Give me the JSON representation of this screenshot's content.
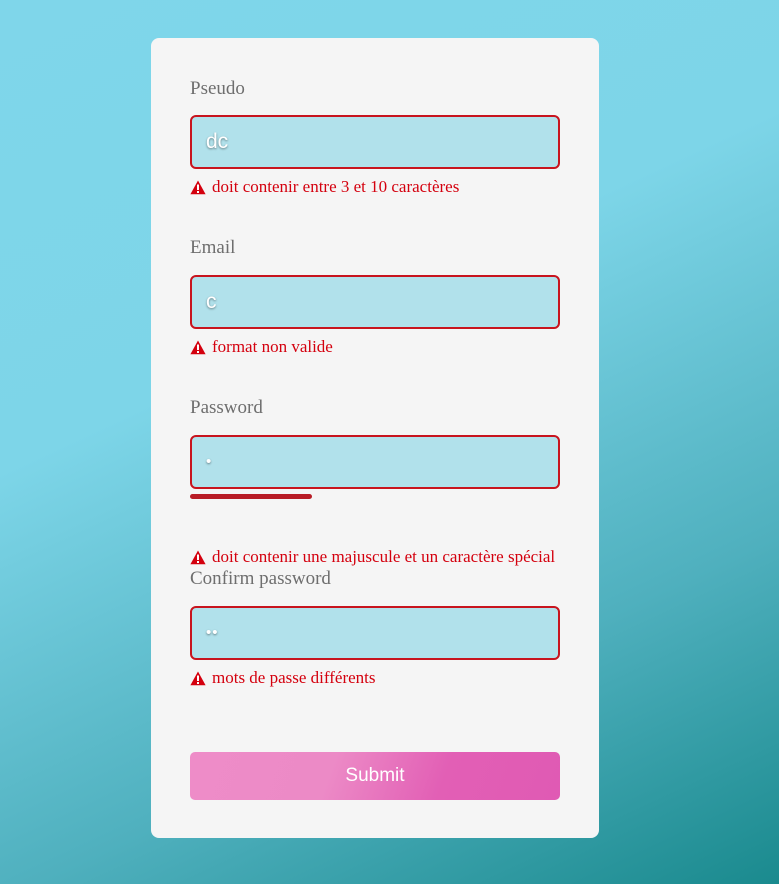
{
  "form": {
    "fields": [
      {
        "label": "Pseudo",
        "value": "dc",
        "error": "doit contenir entre 3 et 10 caractères"
      },
      {
        "label": "Email",
        "value": "c",
        "error": "format non valide"
      },
      {
        "label": "Password",
        "value": "•",
        "error": "doit contenir une majuscule et un caractère spécial",
        "strength": 0.33
      },
      {
        "label": "Confirm password",
        "value": "••",
        "error": "mots de passe différents"
      }
    ],
    "submit_label": "Submit"
  },
  "colors": {
    "error": "#d4000e",
    "input_background": "#b1e1eb",
    "strength_bar": "#b81c26",
    "button": "#e25fb5"
  },
  "icons": {
    "error": "warning-icon"
  }
}
